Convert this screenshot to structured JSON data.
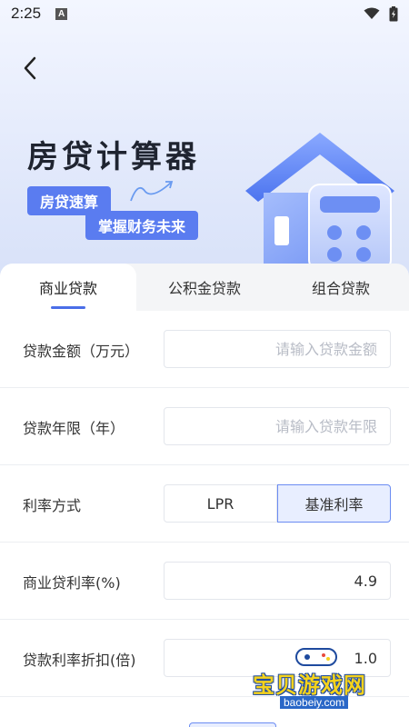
{
  "status_bar": {
    "time": "2:25",
    "notification_badge": "A"
  },
  "header": {
    "title": "房贷计算器",
    "tag_1": "房贷速算",
    "tag_2": "掌握财务未来"
  },
  "tabs": [
    {
      "label": "商业贷款",
      "active": true
    },
    {
      "label": "公积金贷款",
      "active": false
    },
    {
      "label": "组合贷款",
      "active": false
    }
  ],
  "form": {
    "loan_amount": {
      "label": "贷款金额（万元）",
      "placeholder": "请输入贷款金额",
      "value": ""
    },
    "loan_years": {
      "label": "贷款年限（年）",
      "placeholder": "请输入贷款年限",
      "value": ""
    },
    "rate_mode": {
      "label": "利率方式",
      "options": [
        "LPR",
        "基准利率"
      ],
      "selected": "基准利率"
    },
    "commercial_rate": {
      "label": "商业贷利率(%)",
      "value": "4.9"
    },
    "rate_discount": {
      "label": "贷款利率折扣(倍)",
      "value": "1.0"
    }
  },
  "watermark": {
    "text": "宝贝游戏网",
    "url": "baobeiy.com"
  },
  "colors": {
    "accent": "#5a7cf0",
    "selected_bg": "#e8eeff",
    "selected_border": "#6b8cf2"
  }
}
